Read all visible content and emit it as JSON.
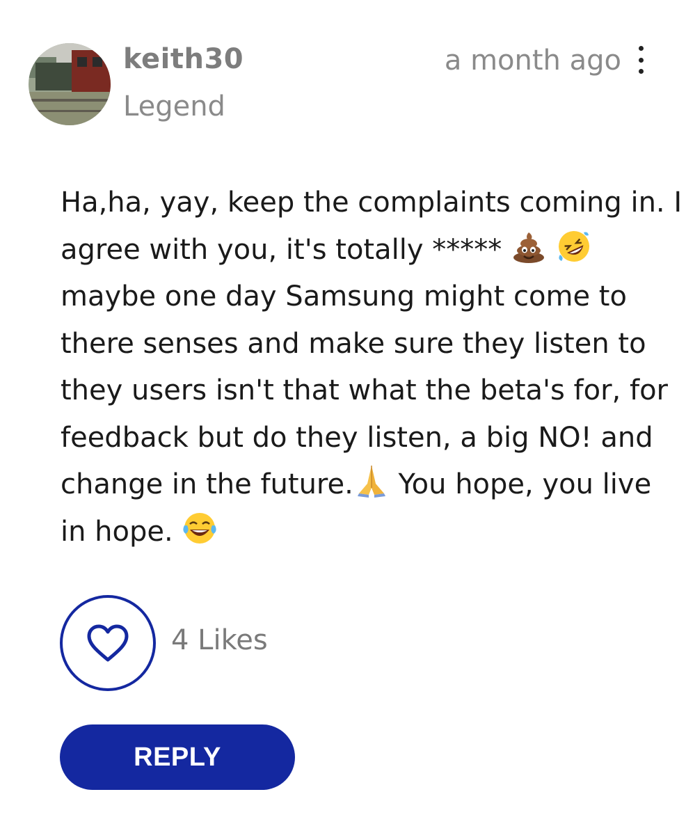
{
  "post": {
    "author": "keith30",
    "rank": "Legend",
    "timestamp": "a month ago",
    "body_lines": [
      {
        "text": "Ha,ha, yay, keep the complaints coming in. I"
      },
      {
        "text": "agree with you, it's totally ***** "
      },
      {
        "text": "maybe one day Samsung might come to"
      },
      {
        "text": "there senses and make sure they listen to"
      },
      {
        "text": "they users isn't that what the beta's for, for"
      },
      {
        "text": "feedback but do they listen, a big NO! and"
      },
      {
        "text": "change in the future."
      },
      {
        "text": "in hope. "
      }
    ],
    "line7_after": " You hope, you live",
    "emojis": [
      "pile-of-poo",
      "rolling-on-the-floor-laughing",
      "folded-hands",
      "face-with-tears-of-joy"
    ]
  },
  "actions": {
    "likes_label": "4 Likes",
    "reply_label": "REPLY"
  },
  "colors": {
    "accent": "#1428a0",
    "muted_text": "#8a8a8a",
    "body_text": "#1a1a1a"
  }
}
